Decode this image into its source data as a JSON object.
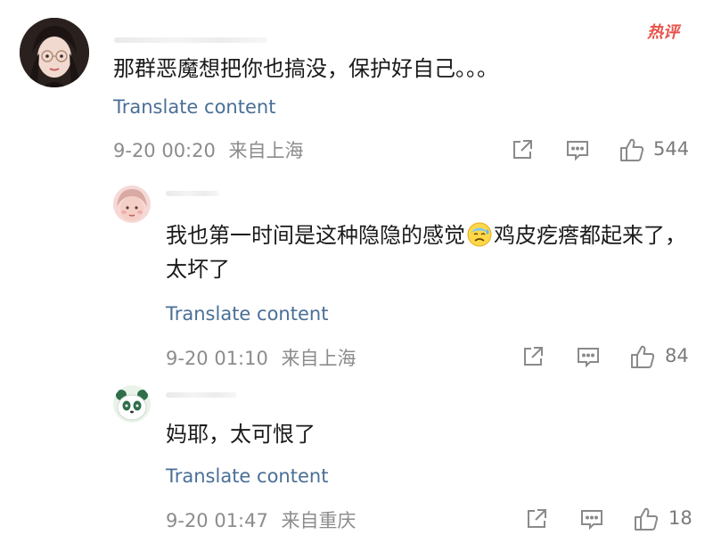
{
  "hot_badge": "热评",
  "comments": [
    {
      "text": "那群恶魔想把你也搞没，保护好自己。。。",
      "translate": "Translate content",
      "time": "9-20 00:20",
      "location": "来自上海",
      "likes": "544"
    },
    {
      "text_before_emoji": "我也第一时间是这种隐隐的感觉",
      "emoji": "cold-sweat-emoji",
      "text_after_emoji": "鸡皮疙瘩都起来了，太坏了",
      "translate": "Translate content",
      "time": "9-20 01:10",
      "location": "来自上海",
      "likes": "84"
    },
    {
      "text": "妈耶，太可恨了",
      "translate": "Translate content",
      "time": "9-20 01:47",
      "location": "来自重庆",
      "likes": "18"
    }
  ],
  "colors": {
    "link": "#4a6f96",
    "meta": "#8c8c8c",
    "text": "#1a1a1a",
    "hot": "#e8524a"
  }
}
